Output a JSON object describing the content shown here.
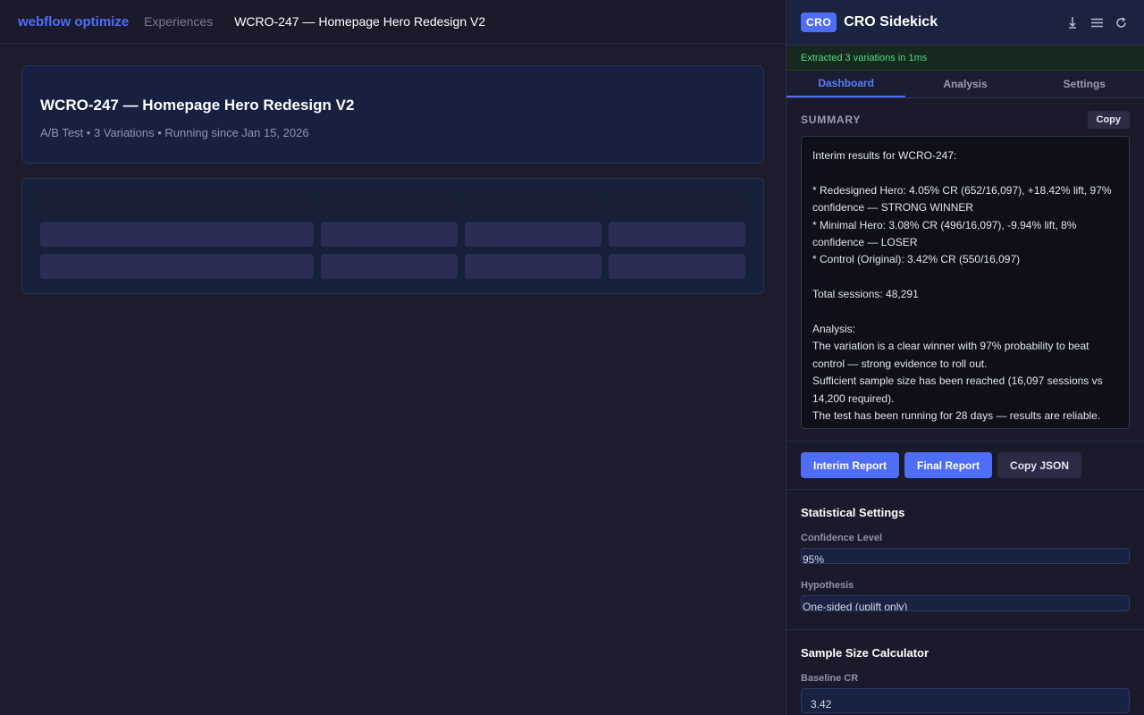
{
  "topbar": {
    "brand": "webflow optimize",
    "crumb": "Experiences",
    "current": "WCRO-247 — Homepage Hero Redesign V2"
  },
  "experience": {
    "title": "WCRO-247 — Homepage Hero Redesign V2",
    "meta": "A/B Test • 3 Variations • Running since Jan 15, 2026"
  },
  "panel": {
    "badge": "CRO",
    "title": "CRO Sidekick",
    "icons": [
      "download-icon",
      "menu-icon",
      "refresh-icon"
    ],
    "status": "Extracted 3 variations in 1ms",
    "tabs": [
      {
        "label": "Dashboard",
        "active": true
      },
      {
        "label": "Analysis",
        "active": false
      },
      {
        "label": "Settings",
        "active": false
      }
    ],
    "summary": {
      "label": "SUMMARY",
      "copy_label": "Copy",
      "text": "Interim results for WCRO-247:\n\n* Redesigned Hero: 4.05% CR (652/16,097), +18.42% lift, 97% confidence — STRONG WINNER\n* Minimal Hero: 3.08% CR (496/16,097), -9.94% lift, 8% confidence — LOSER\n* Control (Original): 3.42% CR (550/16,097)\n\nTotal sessions: 48,291\n\nAnalysis:\nThe variation is a clear winner with 97% probability to beat control — strong evidence to roll out.\nSufficient sample size has been reached (16,097 sessions vs 14,200 required).\nThe test has been running for 28 days — results are reliable."
    },
    "buttons": {
      "interim": "Interim Report",
      "final": "Final Report",
      "json": "Copy JSON"
    },
    "stat_settings": {
      "title": "Statistical Settings",
      "confidence_label": "Confidence Level",
      "confidence_value": "95%",
      "hypothesis_label": "Hypothesis",
      "hypothesis_value": "One-sided (uplift only)"
    },
    "calculator": {
      "title": "Sample Size Calculator",
      "baseline_label": "Baseline CR",
      "baseline_value": "3.42"
    }
  },
  "colors": {
    "accent": "#4f6ef7",
    "success": "#4ade80"
  }
}
